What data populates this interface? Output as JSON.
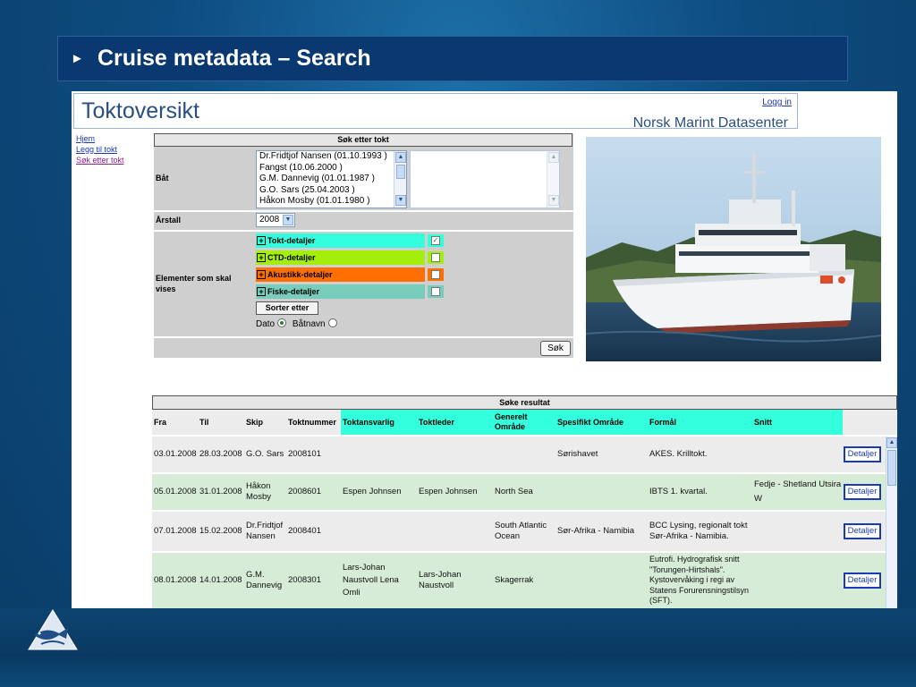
{
  "slide": {
    "title": "Cruise metadata – Search"
  },
  "header": {
    "app_name": "Toktoversikt",
    "login_link": "Logg in",
    "org_name": "Norsk Marint Datasenter"
  },
  "nav": {
    "items": [
      {
        "label": "Hjem"
      },
      {
        "label": "Legg til tokt"
      },
      {
        "label": "Søk etter tokt"
      }
    ]
  },
  "search_form": {
    "heading": "Søk etter tokt",
    "boat_label": "Båt",
    "boat_options": [
      "Dr.Fridtjof Nansen (01.10.1993 )",
      "Fangst (10.06.2000 )",
      "G.M. Dannevig (01.01.1987 )",
      "G.O. Sars (25.04.2003 )",
      "Håkon Mosby (01.01.1980 )"
    ],
    "year_label": "Årstall",
    "year_value": "2008",
    "elements_label": "Elementer som skal vises",
    "elements": [
      {
        "label": "Tokt-detaljer",
        "color": "#33ffdd",
        "checked": true,
        "check_mark": "✓"
      },
      {
        "label": "CTD-detaljer",
        "color": "#a3ee0a",
        "checked": false,
        "check_mark": ""
      },
      {
        "label": "Akustikk-detaljer",
        "color": "#ff6e00",
        "checked": false,
        "check_mark": ""
      },
      {
        "label": "Fiske-detaljer",
        "color": "#77ccbb",
        "checked": false,
        "check_mark": ""
      }
    ],
    "sort_button": "Sorter etter",
    "sort_options": {
      "date": "Dato",
      "boat": "Båtnavn",
      "selected": "Dato"
    },
    "submit_button": "Søk"
  },
  "results": {
    "heading": "Søke resultat",
    "columns": [
      "Fra",
      "Til",
      "Skip",
      "Toktnummer",
      "Toktansvarlig",
      "Toktleder",
      "Generelt Område",
      "Spesifikt Område",
      "Formål",
      "Snitt"
    ],
    "rows": [
      {
        "fra": "03.01.2008",
        "til": "28.03.2008",
        "skip": "G.O. Sars",
        "toktnummer": "2008101",
        "toktansvarlig": "",
        "toktleder": "",
        "generelt": "",
        "spesifikt": "Sørishavet",
        "formal": "AKES. Krilltokt.",
        "snitt": "",
        "button": "Detaljer"
      },
      {
        "fra": "05.01.2008",
        "til": "31.01.2008",
        "skip": "Håkon Mosby",
        "toktnummer": "2008601",
        "toktansvarlig": "Espen Johnsen",
        "toktleder": "Espen Johnsen",
        "generelt": "North Sea",
        "spesifikt": "",
        "formal": "IBTS 1. kvartal.",
        "snitt": "Fedje - Shetland Utsira W",
        "button": "Detaljer"
      },
      {
        "fra": "07.01.2008",
        "til": "15.02.2008",
        "skip": "Dr.Fridtjof Nansen",
        "toktnummer": "2008401",
        "toktansvarlig": "",
        "toktleder": "",
        "generelt": "South Atlantic Ocean",
        "spesifikt": "Sør-Afrika - Namibia",
        "formal": "BCC Lysing, regionalt tokt Sør-Afrika - Namibia.",
        "snitt": "",
        "button": "Detaljer"
      },
      {
        "fra": "08.01.2008",
        "til": "14.01.2008",
        "skip": "G.M. Dannevig",
        "toktnummer": "2008301",
        "toktansvarlig": "Lars-Johan Naustvoll Lena Omli",
        "toktleder": "Lars-Johan Naustvoll",
        "generelt": "Skagerrak",
        "spesifikt": "",
        "formal": "Eutrofi. Hydrografisk snitt \"Torungen-Hirtshals\". Kystovervåking i regi av Statens Forurensningstilsyn (SFT).",
        "snitt": "",
        "button": "Detaljer"
      }
    ]
  },
  "colors": {
    "slide_bg": "#0e4c7e",
    "title_bar": "#0a3870",
    "header_cyan": "#33ffdd",
    "row_odd": "#ececec",
    "row_even": "#d6ecd6",
    "link": "#1b3bb5"
  },
  "icons": {
    "bullet": "triangle-right-icon",
    "scroll_up": "scroll-up-icon",
    "scroll_down": "scroll-down-icon",
    "dropdown": "chevron-down-icon",
    "expand": "plus-box-icon",
    "logo": "fish-logo-icon"
  }
}
